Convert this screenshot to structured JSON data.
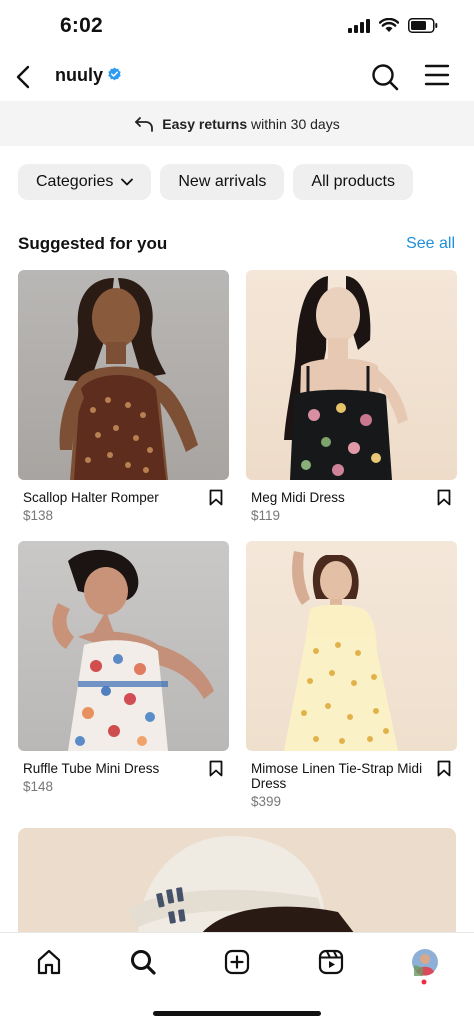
{
  "status": {
    "time": "6:02",
    "icons": [
      "cellular-signal-icon",
      "wifi-icon",
      "battery-icon"
    ]
  },
  "header": {
    "account_name": "nuuly",
    "verified": true,
    "icons": [
      "back-arrow-icon",
      "verified-badge-icon",
      "search-icon",
      "menu-icon"
    ]
  },
  "banner": {
    "bold_text": "Easy returns",
    "text": "within 30 days",
    "icon": "return-arrow-icon"
  },
  "chips": [
    {
      "label": "Categories",
      "has_dropdown": true
    },
    {
      "label": "New arrivals"
    },
    {
      "label": "All products"
    }
  ],
  "section": {
    "title": "Suggested for you",
    "see_all": "See all"
  },
  "products": [
    {
      "name": "Scallop Halter Romper",
      "price": "$138"
    },
    {
      "name": "Meg Midi Dress",
      "price": "$119"
    },
    {
      "name": "Ruffle Tube Mini Dress",
      "price": "$148"
    },
    {
      "name": "Mimose Linen Tie-Strap Midi Dress",
      "price": "$399"
    }
  ],
  "tab_bar": {
    "tabs": [
      "home-icon",
      "search-icon",
      "create-post-icon",
      "reels-icon",
      "profile-avatar"
    ],
    "active": "search-icon",
    "profile_notification_dot": true
  },
  "colors": {
    "accent": "#1e8fdb",
    "verified": "#2d9cf0",
    "banner_bg": "#f4f4f4",
    "chip_bg": "#efefef",
    "notification_dot": "#ed2c41"
  }
}
